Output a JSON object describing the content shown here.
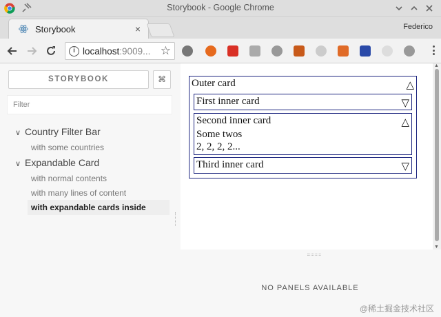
{
  "window": {
    "title": "Storybook - Google Chrome",
    "profile_name": "Federico"
  },
  "tabs": [
    {
      "label": "Storybook",
      "active": true
    }
  ],
  "toolbar": {
    "url_host": "localhost",
    "url_rest": ":9009..."
  },
  "storybook": {
    "brand_button": "STORYBOOK",
    "shortcut_button": "⌘",
    "filter_placeholder": "Filter",
    "tree": [
      {
        "kind": "Country Filter Bar",
        "expanded": true,
        "stories": [
          "with some countries"
        ]
      },
      {
        "kind": "Expandable Card",
        "expanded": true,
        "stories": [
          "with normal contents",
          "with many lines of content",
          "with expandable cards inside"
        ],
        "active_story": "with expandable cards inside"
      }
    ],
    "no_panels": "NO PANELS AVAILABLE"
  },
  "preview": {
    "outer_card": {
      "title": "Outer card",
      "expanded": true
    },
    "inner_cards": [
      {
        "title": "First inner card",
        "expanded": false,
        "lines": []
      },
      {
        "title": "Second inner card",
        "expanded": true,
        "lines": [
          "Some twos",
          "2, 2, 2, 2..."
        ]
      },
      {
        "title": "Third inner card",
        "expanded": false,
        "lines": []
      }
    ]
  },
  "watermark": "@稀土掘金技术社区",
  "colors": {
    "card_border": "#1a237e",
    "active_story_bg": "#eeeeee"
  },
  "icons": {
    "collapse_arrow": "△",
    "expand_arrow": "▽"
  }
}
